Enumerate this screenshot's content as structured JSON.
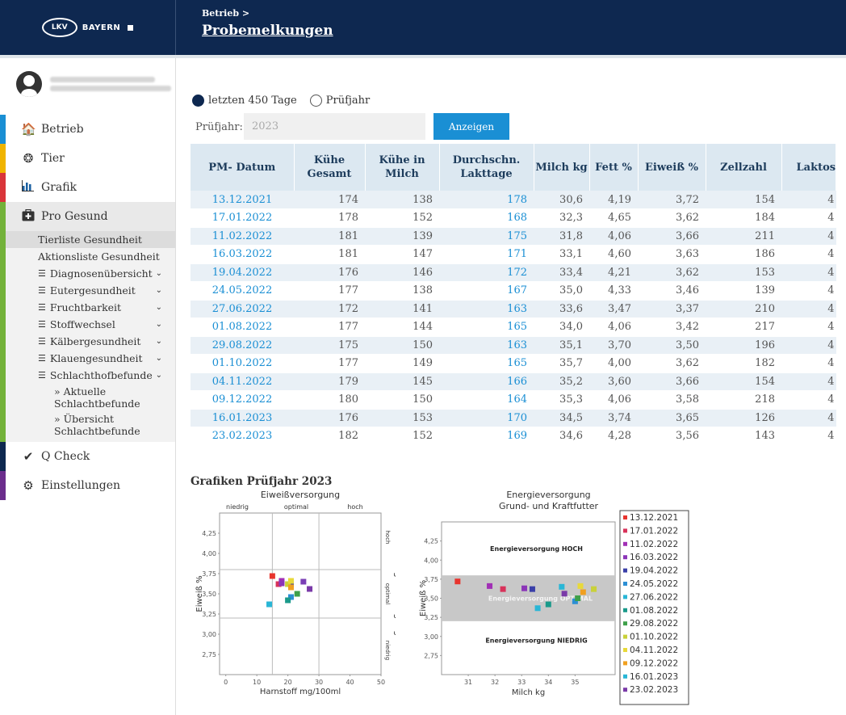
{
  "header": {
    "logo_badge": "LKV",
    "logo_text": "BAYERN",
    "breadcrumb": "Betrieb >",
    "title": "Probemelkungen"
  },
  "sidebar": {
    "nav": [
      {
        "label": "Betrieb",
        "icon": "home-icon",
        "color": "#1a8fd4"
      },
      {
        "label": "Tier",
        "icon": "paw-icon",
        "color": "#f0b400"
      },
      {
        "label": "Grafik",
        "icon": "bar-chart-icon",
        "color": "#d9353a"
      },
      {
        "label": "Pro Gesund",
        "icon": "medical-kit-icon",
        "color": "#73b23a"
      }
    ],
    "pro_gesund_items": [
      "Tierliste Gesundheit",
      "Aktionsliste Gesundheit",
      "Diagnosenübersicht",
      "Eutergesundheit",
      "Fruchtbarkeit",
      "Stoffwechsel",
      "Kälbergesundheit",
      "Klauengesundheit",
      "Schlachthofbefunde"
    ],
    "schlacht_subitems": [
      "» Aktuelle Schlachtbefunde",
      "» Übersicht Schlachtbefunde"
    ],
    "bottom_nav": [
      {
        "label": "Q Check",
        "icon": "check-icon",
        "color": "#0e2850"
      },
      {
        "label": "Einstellungen",
        "icon": "gears-icon",
        "color": "#6b2d8c"
      }
    ]
  },
  "filter": {
    "option1": "letzten 450 Tage",
    "option2": "Prüfjahr",
    "year_label": "Prüfjahr:",
    "year_value": "2023",
    "button": "Anzeigen"
  },
  "table": {
    "headers": [
      "PM- Datum",
      "Kühe Gesamt",
      "Kühe in Milch",
      "Durchschn. Lakttage",
      "Milch kg",
      "Fett %",
      "Eiweiß %",
      "Zellzahl",
      "Laktos"
    ],
    "rows": [
      [
        "13.12.2021",
        "174",
        "138",
        "178",
        "30,6",
        "4,19",
        "3,72",
        "154",
        "4"
      ],
      [
        "17.01.2022",
        "178",
        "152",
        "168",
        "32,3",
        "4,65",
        "3,62",
        "184",
        "4"
      ],
      [
        "11.02.2022",
        "181",
        "139",
        "175",
        "31,8",
        "4,06",
        "3,66",
        "211",
        "4"
      ],
      [
        "16.03.2022",
        "181",
        "147",
        "171",
        "33,1",
        "4,60",
        "3,63",
        "186",
        "4"
      ],
      [
        "19.04.2022",
        "176",
        "146",
        "172",
        "33,4",
        "4,21",
        "3,62",
        "153",
        "4"
      ],
      [
        "24.05.2022",
        "177",
        "138",
        "167",
        "35,0",
        "4,33",
        "3,46",
        "139",
        "4"
      ],
      [
        "27.06.2022",
        "172",
        "141",
        "163",
        "33,6",
        "3,47",
        "3,37",
        "210",
        "4"
      ],
      [
        "01.08.2022",
        "177",
        "144",
        "165",
        "34,0",
        "4,06",
        "3,42",
        "217",
        "4"
      ],
      [
        "29.08.2022",
        "175",
        "150",
        "163",
        "35,1",
        "3,70",
        "3,50",
        "196",
        "4"
      ],
      [
        "01.10.2022",
        "177",
        "149",
        "165",
        "35,7",
        "4,00",
        "3,62",
        "182",
        "4"
      ],
      [
        "04.11.2022",
        "179",
        "145",
        "166",
        "35,2",
        "3,60",
        "3,66",
        "154",
        "4"
      ],
      [
        "09.12.2022",
        "180",
        "150",
        "164",
        "35,3",
        "4,06",
        "3,58",
        "218",
        "4"
      ],
      [
        "16.01.2023",
        "176",
        "153",
        "170",
        "34,5",
        "3,74",
        "3,65",
        "126",
        "4"
      ],
      [
        "23.02.2023",
        "182",
        "152",
        "169",
        "34,6",
        "4,28",
        "3,56",
        "143",
        "4"
      ]
    ]
  },
  "graphs_title": "Grafiken Prüfjahr 2023",
  "chart_data": [
    {
      "type": "scatter",
      "title": "Eiweißversorgung",
      "top_labels": [
        "niedrig",
        "optimal",
        "hoch"
      ],
      "right_title": "Energieversorgung",
      "right_labels": [
        "hoch",
        "optimal",
        "niedrig"
      ],
      "xlabel": "Harnstoff mg/100ml",
      "ylabel": "Eiweiß %",
      "xlim": [
        -2,
        50
      ],
      "ylim": [
        2.5,
        4.5
      ],
      "xticks": [
        0,
        10,
        20,
        30,
        40,
        50
      ],
      "yticks": [
        2.75,
        3.0,
        3.25,
        3.5,
        3.75,
        4.0,
        4.25
      ],
      "xticklabels": [
        "0",
        "10",
        "20",
        "30",
        "40",
        "50"
      ],
      "yticklabels": [
        "2,75",
        "3,00",
        "3,25",
        "3,50",
        "3,75",
        "4,00",
        "4,25"
      ],
      "vlines": [
        15,
        30
      ],
      "hlines": [
        3.2,
        3.8
      ],
      "points": [
        {
          "x": 15,
          "y": 3.72,
          "color": "#e8342e"
        },
        {
          "x": 17,
          "y": 3.62,
          "color": "#d8325a"
        },
        {
          "x": 18,
          "y": 3.66,
          "color": "#a12fb5"
        },
        {
          "x": 18,
          "y": 3.63,
          "color": "#8b35b8"
        },
        {
          "x": 21,
          "y": 3.62,
          "color": "#3a3fa8"
        },
        {
          "x": 21,
          "y": 3.46,
          "color": "#2c8fd4"
        },
        {
          "x": 14,
          "y": 3.37,
          "color": "#29b6d6"
        },
        {
          "x": 20,
          "y": 3.42,
          "color": "#1a9a8a"
        },
        {
          "x": 23,
          "y": 3.5,
          "color": "#3ea04a"
        },
        {
          "x": 20,
          "y": 3.62,
          "color": "#c9d13a"
        },
        {
          "x": 21,
          "y": 3.66,
          "color": "#e8d93a"
        },
        {
          "x": 21,
          "y": 3.58,
          "color": "#f0a020"
        },
        {
          "x": 25,
          "y": 3.65,
          "color": "#7b3fb5"
        },
        {
          "x": 27,
          "y": 3.56,
          "color": "#7a3aa8"
        }
      ]
    },
    {
      "type": "scatter",
      "title": "Energieversorgung",
      "subtitle": "Grund- und Kraftfutter",
      "xlabel": "Milch kg",
      "ylabel": "Eiweiß %",
      "xlim": [
        30,
        36.5
      ],
      "ylim": [
        2.5,
        4.5
      ],
      "xticks": [
        31,
        32,
        33,
        34,
        35
      ],
      "yticks": [
        2.75,
        3.0,
        3.25,
        3.5,
        3.75,
        4.0,
        4.25
      ],
      "xticklabels": [
        "31",
        "32",
        "33",
        "34",
        "35"
      ],
      "yticklabels": [
        "2,75",
        "3,00",
        "3,25",
        "3,50",
        "3,75",
        "4,00",
        "4,25"
      ],
      "band": [
        3.2,
        3.8
      ],
      "band_color": "#c8c8c8",
      "zones": [
        "Energieversorgung HOCH",
        "Energieversorgung OPTIMAL",
        "Energieversorgung NIEDRIG"
      ],
      "series": [
        {
          "name": "13.12.2021",
          "x": 30.6,
          "y": 3.72,
          "color": "#e8342e"
        },
        {
          "name": "17.01.2022",
          "x": 32.3,
          "y": 3.62,
          "color": "#d8325a"
        },
        {
          "name": "11.02.2022",
          "x": 31.8,
          "y": 3.66,
          "color": "#a12fb5"
        },
        {
          "name": "16.03.2022",
          "x": 33.1,
          "y": 3.63,
          "color": "#8b35b8"
        },
        {
          "name": "19.04.2022",
          "x": 33.4,
          "y": 3.62,
          "color": "#3a3fa8"
        },
        {
          "name": "24.05.2022",
          "x": 35.0,
          "y": 3.46,
          "color": "#2c8fd4"
        },
        {
          "name": "27.06.2022",
          "x": 33.6,
          "y": 3.37,
          "color": "#29b6d6"
        },
        {
          "name": "01.08.2022",
          "x": 34.0,
          "y": 3.42,
          "color": "#1a9a8a"
        },
        {
          "name": "29.08.2022",
          "x": 35.1,
          "y": 3.5,
          "color": "#3ea04a"
        },
        {
          "name": "01.10.2022",
          "x": 35.7,
          "y": 3.62,
          "color": "#c9d13a"
        },
        {
          "name": "04.11.2022",
          "x": 35.2,
          "y": 3.66,
          "color": "#e8d93a"
        },
        {
          "name": "09.12.2022",
          "x": 35.3,
          "y": 3.58,
          "color": "#f0a020"
        },
        {
          "name": "16.01.2023",
          "x": 34.5,
          "y": 3.65,
          "color": "#29b6d6"
        },
        {
          "name": "23.02.2023",
          "x": 34.6,
          "y": 3.56,
          "color": "#7a3aa8"
        }
      ]
    }
  ]
}
